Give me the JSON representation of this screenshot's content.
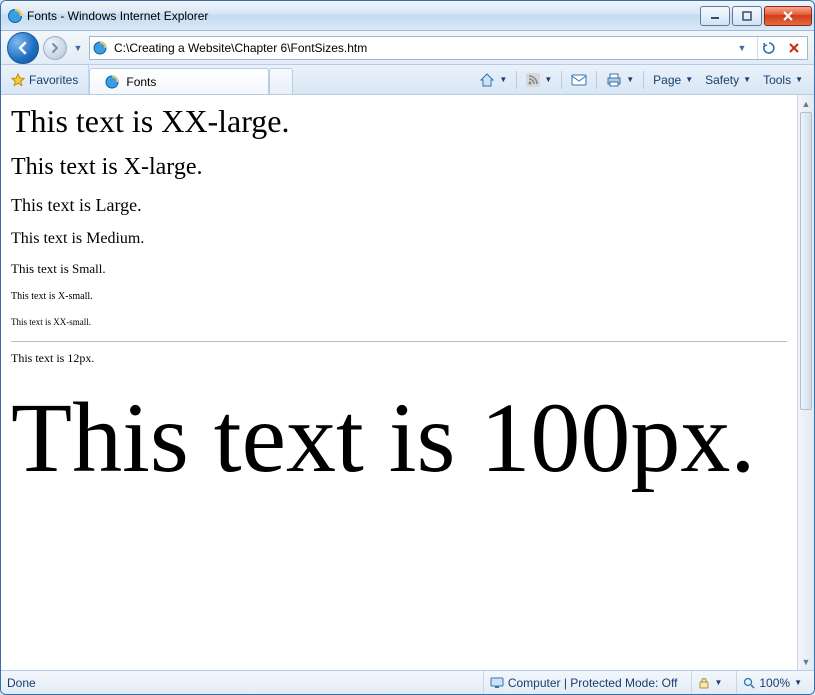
{
  "window": {
    "title": "Fonts - Windows Internet Explorer"
  },
  "navbar": {
    "address": "C:\\Creating a Website\\Chapter 6\\FontSizes.htm"
  },
  "favbar": {
    "favorites_label": "Favorites"
  },
  "tab": {
    "label": "Fonts"
  },
  "cmdbar": {
    "page_label": "Page",
    "safety_label": "Safety",
    "tools_label": "Tools"
  },
  "page": {
    "xxlarge": "This text is XX-large.",
    "xlarge": "This text is X-large.",
    "large": "This text is Large.",
    "medium": "This text is Medium.",
    "small": "This text is Small.",
    "xsmall": "This text is X-small.",
    "xxsmall": "This text is XX-small.",
    "px12": "This text is 12px.",
    "px100": "This text is 100px."
  },
  "status": {
    "done": "Done",
    "zone": "Computer | Protected Mode: Off",
    "zoom": "100%"
  }
}
